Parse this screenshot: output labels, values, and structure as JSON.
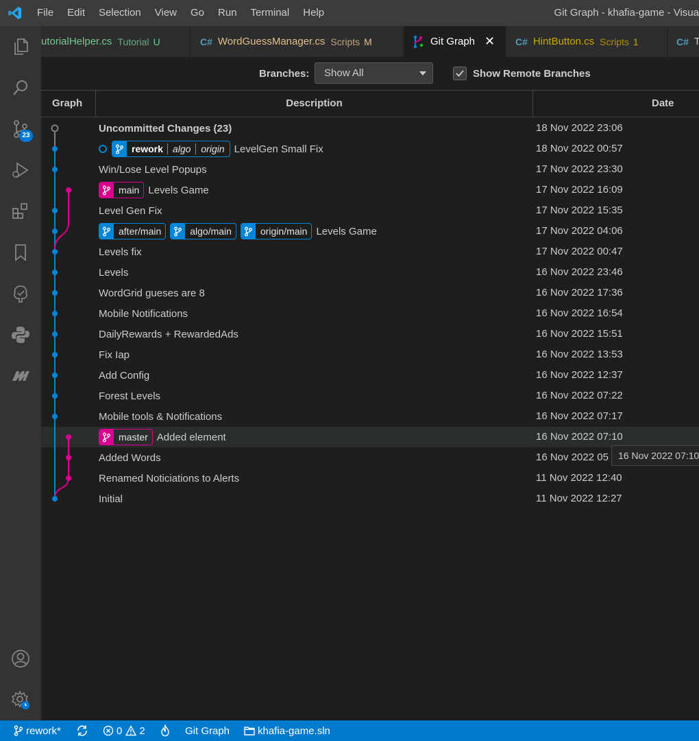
{
  "titlebar": {
    "menu": [
      "File",
      "Edit",
      "Selection",
      "View",
      "Go",
      "Run",
      "Terminal",
      "Help"
    ],
    "window_title": "Git Graph - khafia-game - Visua"
  },
  "activity": {
    "scm_badge": "23",
    "icons": [
      "explorer-icon",
      "search-icon",
      "source-control-icon",
      "run-debug-icon",
      "extensions-icon",
      "bookmarks-icon",
      "git-tree-icon",
      "python-icon",
      "m-logo-icon",
      "account-icon",
      "settings-gear-icon"
    ]
  },
  "tabs": [
    {
      "name": "utorialHelper.cs",
      "desc": "Tutorial",
      "status": "U",
      "lang": ""
    },
    {
      "name": "WordGuessManager.cs",
      "desc": "Scripts",
      "status": "M",
      "lang": "C#"
    },
    {
      "name": "Git Graph",
      "desc": "",
      "status": "",
      "lang": "",
      "active": true
    },
    {
      "name": "HintButton.cs",
      "desc": "Scripts",
      "status": "1",
      "lang": "C#"
    },
    {
      "name": "T",
      "desc": "",
      "status": "",
      "lang": "C#"
    }
  ],
  "controls": {
    "branches_label": "Branches:",
    "branches_value": "Show All",
    "remote_checked": true,
    "remote_label": "Show Remote Branches"
  },
  "table": {
    "headers": {
      "graph": "Graph",
      "description": "Description",
      "date": "Date"
    },
    "rows": [
      {
        "desc": "Uncommitted Changes (23)",
        "date": "18 Nov 2022 23:06",
        "bold": true,
        "refs": []
      },
      {
        "desc": "LevelGen Small Fix",
        "date": "18 Nov 2022 00:57",
        "head": true,
        "refs": [
          {
            "name": "rework",
            "remotes": [
              "algo",
              "origin"
            ],
            "color": "blue",
            "bold": true
          }
        ]
      },
      {
        "desc": "Win/Lose Level Popups",
        "date": "17 Nov 2022 23:30",
        "refs": []
      },
      {
        "desc": "Levels Game",
        "date": "17 Nov 2022 16:09",
        "refs": [
          {
            "name": "main",
            "remotes": [],
            "color": "pink"
          }
        ]
      },
      {
        "desc": "Level Gen Fix",
        "date": "17 Nov 2022 15:35",
        "refs": []
      },
      {
        "desc": "Levels Game",
        "date": "17 Nov 2022 04:06",
        "refs": [
          {
            "name": "after/main",
            "remotes": [],
            "color": "blue"
          },
          {
            "name": "algo/main",
            "remotes": [],
            "color": "blue"
          },
          {
            "name": "origin/main",
            "remotes": [],
            "color": "blue"
          }
        ]
      },
      {
        "desc": "Levels fix",
        "date": "17 Nov 2022 00:47",
        "refs": []
      },
      {
        "desc": "Levels",
        "date": "16 Nov 2022 23:46",
        "refs": []
      },
      {
        "desc": "WordGrid gueses are 8",
        "date": "16 Nov 2022 17:36",
        "refs": []
      },
      {
        "desc": "Mobile Notifications",
        "date": "16 Nov 2022 16:54",
        "refs": []
      },
      {
        "desc": "DailyRewards + RewardedAds",
        "date": "16 Nov 2022 15:51",
        "refs": []
      },
      {
        "desc": "Fix Iap",
        "date": "16 Nov 2022 13:53",
        "refs": []
      },
      {
        "desc": "Add Config",
        "date": "16 Nov 2022 12:37",
        "refs": []
      },
      {
        "desc": "Forest Levels",
        "date": "16 Nov 2022 07:22",
        "refs": []
      },
      {
        "desc": "Mobile tools & Notifications",
        "date": "16 Nov 2022 07:17",
        "refs": []
      },
      {
        "desc": "Added element",
        "date": "16 Nov 2022 07:10",
        "highlight": true,
        "refs": [
          {
            "name": "master",
            "remotes": [],
            "color": "pink"
          }
        ]
      },
      {
        "desc": "Added Words",
        "date": "16 Nov 2022 05",
        "refs": []
      },
      {
        "desc": "Renamed Noticiations to Alerts",
        "date": "11 Nov 2022 12:40",
        "refs": []
      },
      {
        "desc": "Initial",
        "date": "11 Nov 2022 12:27",
        "refs": []
      }
    ]
  },
  "graph": {
    "lane_colors": {
      "uncommitted": "#808080",
      "main": "#0085d9",
      "branch": "#d9008f"
    },
    "lanes": [
      0,
      0,
      0,
      1,
      0,
      0,
      0,
      0,
      0,
      0,
      0,
      0,
      0,
      0,
      0,
      1,
      1,
      1,
      0
    ]
  },
  "tooltip": "16 Nov 2022 07:10",
  "statusbar": {
    "branch": "rework*",
    "errors": "0",
    "warnings": "2",
    "git_graph": "Git Graph",
    "solution": "khafia-game.sln"
  }
}
